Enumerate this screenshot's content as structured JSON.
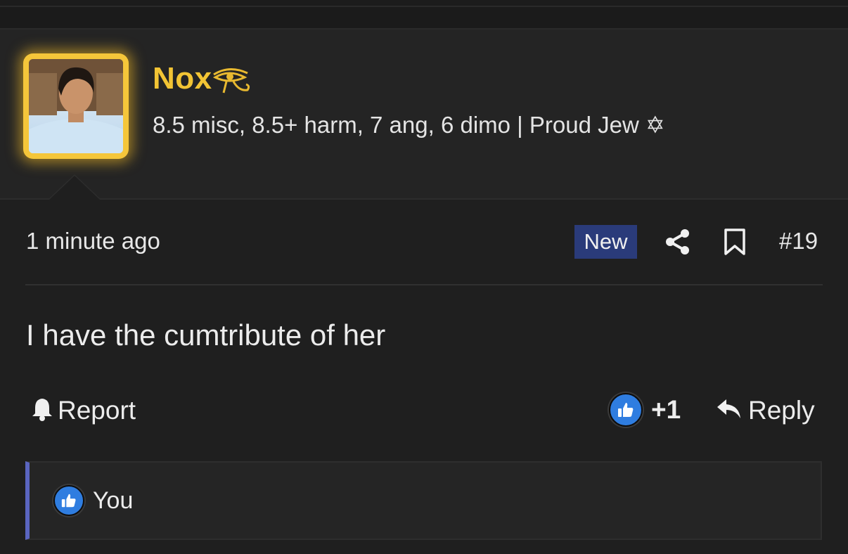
{
  "post": {
    "username": "Nox",
    "user_title": "8.5 misc, 8.5+ harm, 7 ang, 6 dimo | Proud Jew ✡",
    "timestamp": "1 minute ago",
    "badge": "New",
    "post_number": "#19",
    "body": "I have the cumtribute of her"
  },
  "actions": {
    "report_label": "Report",
    "like_count": "+1",
    "reply_label": "Reply"
  },
  "reactions": {
    "users": [
      "You"
    ]
  },
  "colors": {
    "username": "#f2c434",
    "avatar_glow": "#f5c63a",
    "badge_bg": "#2a3b7a",
    "like_blue": "#2f7de0",
    "reaction_accent": "#5a65c0"
  },
  "icons": {
    "username_decoration": "eye-of-horus-icon",
    "share": "share-icon",
    "bookmark": "bookmark-icon",
    "report": "bell-icon",
    "like": "thumbs-up-icon",
    "reply": "reply-arrow-icon"
  }
}
